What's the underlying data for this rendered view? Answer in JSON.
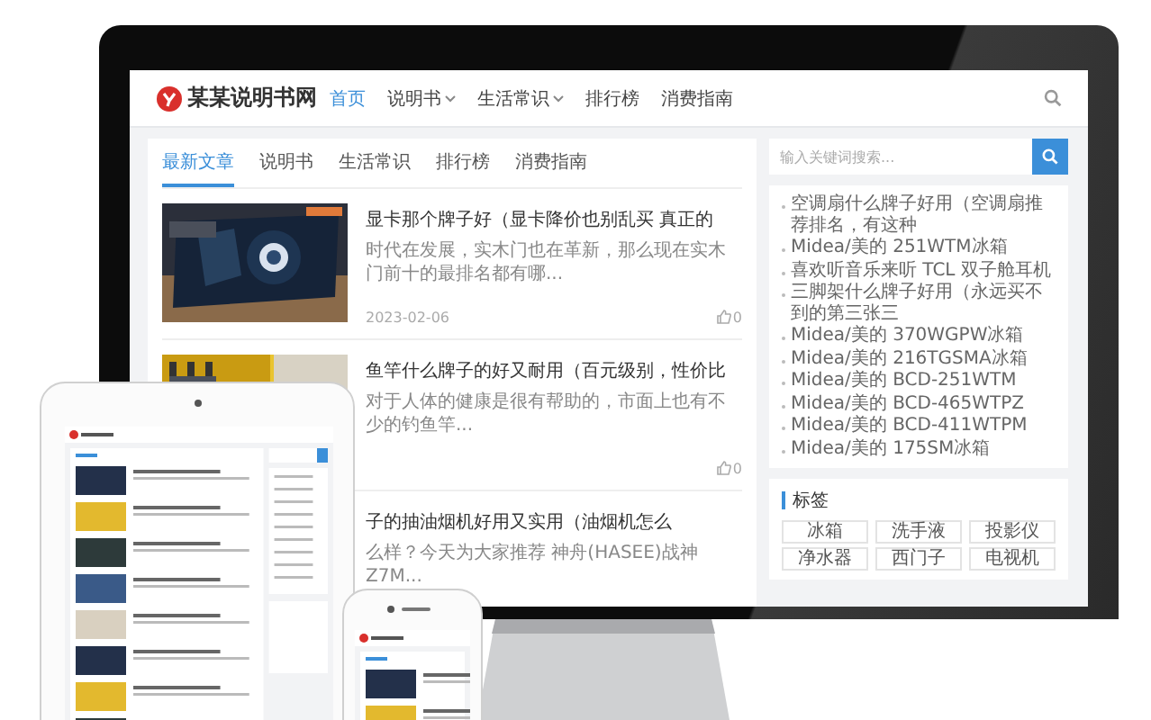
{
  "site": {
    "logo": "某某说明书网",
    "nav": [
      {
        "label": "首页",
        "selected": true,
        "dropdown": false
      },
      {
        "label": "说明书",
        "selected": false,
        "dropdown": true
      },
      {
        "label": "生活常识",
        "selected": false,
        "dropdown": true
      },
      {
        "label": "排行榜",
        "selected": false,
        "dropdown": false
      },
      {
        "label": "消费指南",
        "selected": false,
        "dropdown": false
      }
    ]
  },
  "tabs": [
    {
      "label": "最新文章",
      "selected": true
    },
    {
      "label": "说明书",
      "selected": false
    },
    {
      "label": "生活常识",
      "selected": false
    },
    {
      "label": "排行榜",
      "selected": false
    },
    {
      "label": "消费指南",
      "selected": false
    }
  ],
  "articles": [
    {
      "title": "显卡那个牌子好（显卡降价也别乱买 真正的",
      "excerpt": "时代在发展，实木门也在革新，那么现在实木门前十的最排名都有哪...",
      "date": "2023-02-06",
      "likes": "0"
    },
    {
      "title": "鱼竿什么牌子的好又耐用（百元级别，性价比",
      "excerpt": "对于人体的健康是很有帮助的，市面上也有不少的钓鱼竿...",
      "likes": "0"
    },
    {
      "title": "子的抽油烟机好用又实用（油烟机怎么",
      "excerpt": "么样？今天为大家推荐 神舟(HASEE)战神Z7M..."
    }
  ],
  "sidebar": {
    "search": {
      "placeholder": "输入关键词搜索..."
    },
    "list": [
      "空调扇什么牌子好用（空调扇推荐排名，有这种",
      "Midea/美的 251WTM冰箱",
      "喜欢听音乐来听 TCL 双子舱耳机",
      "三脚架什么牌子好用（永远买不到的第三张三",
      "Midea/美的 370WGPW冰箱",
      "Midea/美的 216TGSMA冰箱",
      "Midea/美的 BCD-251WTM",
      "Midea/美的 BCD-465WTPZ",
      "Midea/美的 BCD-411WTPM",
      "Midea/美的 175SM冰箱"
    ],
    "tags_title": "标签",
    "tags": [
      "冰箱",
      "洗手液",
      "投影仪",
      "净水器",
      "西门子",
      "电视机"
    ]
  }
}
